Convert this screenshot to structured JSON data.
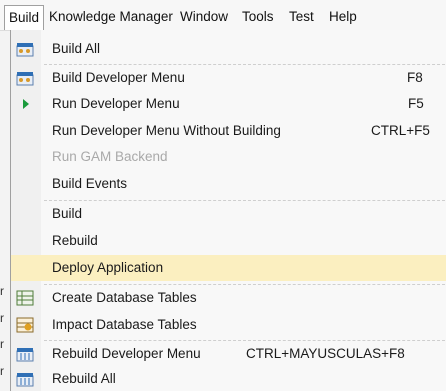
{
  "menubar": {
    "items": [
      "Build",
      "Knowledge Manager",
      "Window",
      "Tools",
      "Test",
      "Help"
    ]
  },
  "underlying": {
    "chars": [
      "r",
      "r",
      "r",
      "r"
    ]
  },
  "build_menu": {
    "items": [
      {
        "label": "Build All",
        "accel": "",
        "icon": "build-all-icon"
      },
      {
        "label": "Build Developer Menu",
        "accel": "F8",
        "icon": "build-developer-menu-icon"
      },
      {
        "label": "Run Developer Menu",
        "accel": "F5",
        "icon": "run-play-icon"
      },
      {
        "label": "Run Developer Menu Without Building",
        "accel": "CTRL+F5",
        "icon": ""
      },
      {
        "label": "Run GAM Backend",
        "accel": "",
        "icon": "",
        "disabled": true
      },
      {
        "label": "Build Events",
        "accel": "",
        "icon": ""
      },
      {
        "label": "Build",
        "accel": "",
        "icon": ""
      },
      {
        "label": "Rebuild",
        "accel": "",
        "icon": ""
      },
      {
        "label": "Deploy Application",
        "accel": "",
        "icon": "",
        "highlighted": true
      },
      {
        "label": "Create Database Tables",
        "accel": "",
        "icon": "create-database-tables-icon"
      },
      {
        "label": "Impact Database Tables",
        "accel": "",
        "icon": "impact-database-tables-icon"
      },
      {
        "label": "Rebuild Developer Menu",
        "accel": "CTRL+MAYUSCULAS+F8",
        "icon": "rebuild-developer-menu-icon"
      },
      {
        "label": "Rebuild All",
        "accel": "",
        "icon": "rebuild-all-icon"
      }
    ]
  },
  "colors": {
    "highlight": "#fbefc0",
    "run_icon": "#1a9b3c",
    "icon_blue": "#2f6fb5",
    "disabled_text": "#a9a9a9"
  }
}
